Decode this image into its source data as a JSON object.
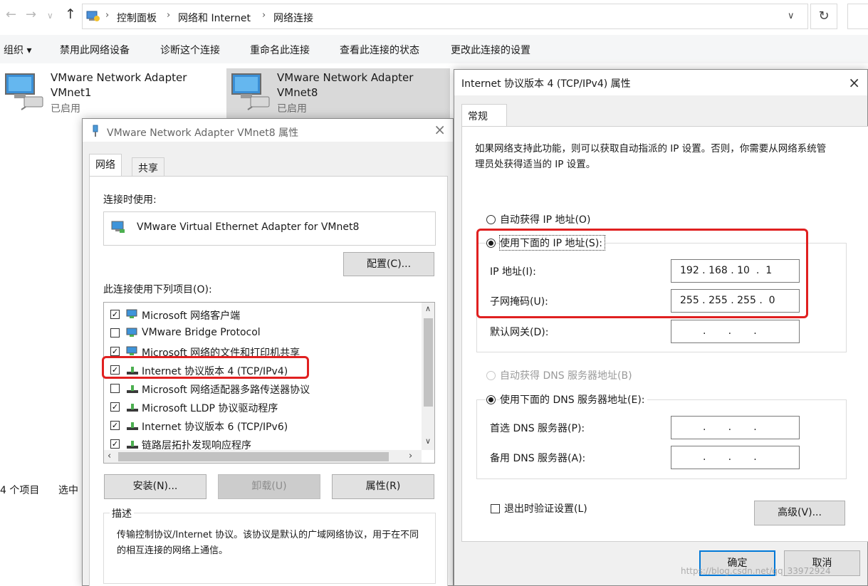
{
  "explorer": {
    "breadcrumb": [
      "控制面板",
      "网络和 Internet",
      "网络连接"
    ],
    "commands": [
      "组织 ▾",
      "禁用此网络设备",
      "诊断这个连接",
      "重命名此连接",
      "查看此连接的状态",
      "更改此连接的设置"
    ],
    "adapters": [
      {
        "name": "VMware Network Adapter",
        "sub": "VMnet1",
        "status": "已启用"
      },
      {
        "name": "VMware Network Adapter",
        "sub": "VMnet8",
        "status": "已启用"
      }
    ],
    "status_count": "4 个项目",
    "status_selected": "选中"
  },
  "vmnet8_dialog": {
    "title": "VMware Network Adapter VMnet8 属性",
    "tabs": [
      "网络",
      "共享"
    ],
    "connect_using_label": "连接时使用:",
    "adapter_name": "VMware Virtual Ethernet Adapter for VMnet8",
    "configure_button": "配置(C)...",
    "items_label": "此连接使用下列项目(O):",
    "items": [
      {
        "label": "Microsoft 网络客户端",
        "checked": true
      },
      {
        "label": "VMware Bridge Protocol",
        "checked": false
      },
      {
        "label": "Microsoft 网络的文件和打印机共享",
        "checked": true
      },
      {
        "label": "Internet 协议版本 4 (TCP/IPv4)",
        "checked": true
      },
      {
        "label": "Microsoft 网络适配器多路传送器协议",
        "checked": false
      },
      {
        "label": "Microsoft LLDP 协议驱动程序",
        "checked": true
      },
      {
        "label": "Internet 协议版本 6 (TCP/IPv6)",
        "checked": true
      },
      {
        "label": "链路层拓扑发现响应程序",
        "checked": true
      }
    ],
    "install_button": "安装(N)...",
    "uninstall_button": "卸载(U)",
    "properties_button": "属性(R)",
    "description_label": "描述",
    "description_text": "传输控制协议/Internet 协议。该协议是默认的广域网络协议，用于在不同的相互连接的网络上通信。"
  },
  "ipv4_dialog": {
    "title": "Internet 协议版本 4 (TCP/IPv4) 属性",
    "tab": "常规",
    "intro": "如果网络支持此功能，则可以获取自动指派的 IP 设置。否则，你需要从网络系统管理员处获得适当的 IP 设置。",
    "auto_ip_label": "自动获得 IP 地址(O)",
    "manual_ip_label": "使用下面的 IP 地址(S):",
    "ip_label": "IP 地址(I):",
    "ip_value": "192 . 168 . 10  .  1",
    "mask_label": "子网掩码(U):",
    "mask_value": "255 . 255 . 255 .  0",
    "gateway_label": "默认网关(D):",
    "gateway_value": ".       .       .",
    "auto_dns_label": "自动获得 DNS 服务器地址(B)",
    "manual_dns_label": "使用下面的 DNS 服务器地址(E):",
    "preferred_dns_label": "首选 DNS 服务器(P):",
    "preferred_dns_value": ".       .       .",
    "alternate_dns_label": "备用 DNS 服务器(A):",
    "alternate_dns_value": ".       .       .",
    "validate_label": "退出时验证设置(L)",
    "advanced_button": "高级(V)...",
    "ok_button": "确定",
    "cancel_button": "取消",
    "watermark": "https://blog.csdn.net/qq_33972924"
  }
}
